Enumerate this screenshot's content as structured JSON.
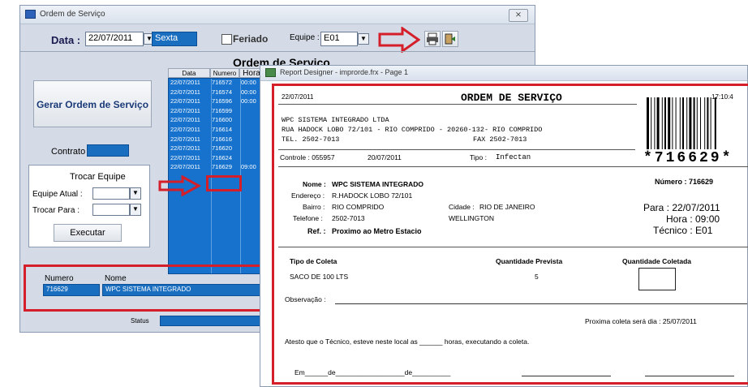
{
  "main_window": {
    "title": "Ordem de Serviço",
    "close_label": "⨯",
    "data_label": "Data :",
    "date_value": "22/07/2011",
    "weekday": "Sexta",
    "feriado_label": "Feriado",
    "equipe_label": "Equipe :",
    "equipe_value": "E01",
    "section_title": "Ordem de Serviço",
    "gerar_button": "Gerar Ordem de Serviço",
    "contrato_label": "Contrato",
    "trocar_title": "Trocar Equipe",
    "equipe_atual_label": "Equipe Atual :",
    "trocar_para_label": "Trocar Para :",
    "executar_button": "Executar",
    "grid_headers": [
      "Data",
      "Numero",
      "Hora"
    ],
    "grid_rows": [
      {
        "data": "22/07/2011",
        "numero": "716572",
        "hora": "00:00"
      },
      {
        "data": "22/07/2011",
        "numero": "716574",
        "hora": "00:00"
      },
      {
        "data": "22/07/2011",
        "numero": "716596",
        "hora": "00:00"
      },
      {
        "data": "22/07/2011",
        "numero": "716599",
        "hora": ""
      },
      {
        "data": "22/07/2011",
        "numero": "716600",
        "hora": ""
      },
      {
        "data": "22/07/2011",
        "numero": "716614",
        "hora": ""
      },
      {
        "data": "22/07/2011",
        "numero": "716616",
        "hora": ""
      },
      {
        "data": "22/07/2011",
        "numero": "716620",
        "hora": ""
      },
      {
        "data": "22/07/2011",
        "numero": "716624",
        "hora": ""
      },
      {
        "data": "22/07/2011",
        "numero": "716629",
        "hora": "09:00"
      }
    ],
    "numero_header": "Numero",
    "nome_header": "Nome",
    "selected_numero": "716629",
    "selected_nome": "WPC SISTEMA INTEGRADO",
    "status_label": "Status"
  },
  "report_window": {
    "title": "Report Designer - improrde.frx - Page 1",
    "date": "22/07/2011",
    "title_text": "ORDEM DE SERVIÇO",
    "time": "17:10:4",
    "company": "WPC SISTEMA INTEGRADO LTDA",
    "address": "RUA HADOCK LOBO 72/101 - RIO COMPRIDO - 20260-132- RIO COMPRIDO",
    "tel": "TEL. 2502-7013",
    "fax": "FAX 2502-7013",
    "barcode_text": "*716629*",
    "controle": "Controle : 055957",
    "controle_date": "20/07/2011",
    "tipo_label": "Tipo :",
    "tipo_value": "Infectan",
    "nome_label": "Nome :",
    "nome_value": "WPC SISTEMA INTEGRADO",
    "endereco_label": "Endereço :",
    "endereco_value": "R.HADOCK LOBO 72/101",
    "bairro_label": "Bairro :",
    "bairro_value": "RIO COMPRIDO",
    "cidade_label": "Cidade :",
    "cidade_value": "RIO DE JANEIRO",
    "telefone_label": "Telefone :",
    "telefone_value": "2502-7013",
    "contact": "WELLINGTON",
    "ref_label": "Ref. :",
    "ref_value": "Proximo ao Metro Estacio",
    "numero_text": "Número : 716629",
    "para_text": "Para : 22/07/2011",
    "hora_text": "Hora : 09:00",
    "tecnico_text": "Técnico : E01",
    "col_tipo": "Tipo de Coleta",
    "col_prevista": "Quantidade Prevista",
    "col_coletada": "Quantidade Coletada",
    "item_tipo": "SACO DE 100 LTS",
    "item_qtd": "5",
    "observacao": "Observação :",
    "proxima": "Proxima coleta será dia :  25/07/2011",
    "atesto": "Atesto que o Técnico, esteve neste local as ______ horas, executando a coleta.",
    "em_line": "Em______de__________________de__________"
  },
  "colors": {
    "highlight": "#d41e2a",
    "grid_blue": "#1672cc",
    "window_bg": "#d4dbe6"
  }
}
